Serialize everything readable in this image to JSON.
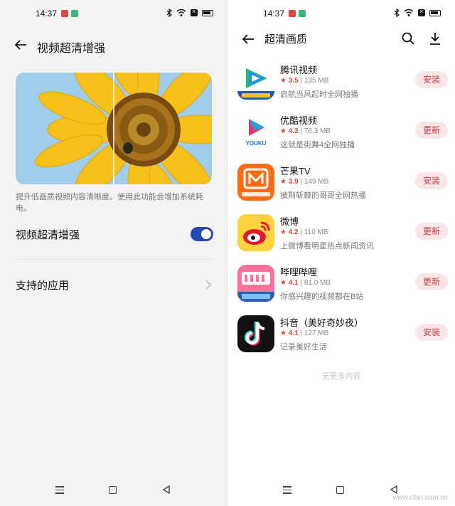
{
  "left": {
    "status": {
      "time": "14:37"
    },
    "header": {
      "title": "视频超清增强"
    },
    "description": "提升低画质视频内容清晰度。使用此功能会增加系统耗电。",
    "toggle_row": {
      "label": "视频超清增强",
      "enabled": true
    },
    "apps_row": {
      "label": "支持的应用"
    }
  },
  "right": {
    "status": {
      "time": "14:37"
    },
    "header": {
      "title": "超清画质"
    },
    "apps": [
      {
        "name": "腾讯视频",
        "rating": "3.5",
        "size": "135 MB",
        "desc": "启航当风起时全网独播",
        "button": "安装",
        "icon": "tencent-video-icon"
      },
      {
        "name": "优酷视频",
        "rating": "4.2",
        "size": "76.3 MB",
        "desc": "这就是街舞4全网独播",
        "button": "更新",
        "icon": "youku-icon"
      },
      {
        "name": "芒果TV",
        "rating": "3.9",
        "size": "149 MB",
        "desc": "披荆斩棘的哥哥全网热播",
        "button": "安装",
        "icon": "mango-tv-icon"
      },
      {
        "name": "微博",
        "rating": "4.2",
        "size": "110 MB",
        "desc": "上微博看明星热点新闻资讯",
        "button": "更新",
        "icon": "weibo-icon"
      },
      {
        "name": "哔哩哔哩",
        "rating": "4.1",
        "size": "81.0 MB",
        "desc": "你感兴趣的视频都在B站",
        "button": "更新",
        "icon": "bilibili-icon"
      },
      {
        "name": "抖音（美好奇妙夜）",
        "rating": "4.1",
        "size": "127 MB",
        "desc": "记录美好生活",
        "button": "安装",
        "icon": "douyin-icon"
      }
    ],
    "no_more": "无更多内容",
    "watermark": "www.cfan.com.cn"
  },
  "colors": {
    "toggle": "#2448b4",
    "button_bg": "#fbe6e7",
    "button_text": "#c93a45",
    "star": "#d14b3b"
  }
}
